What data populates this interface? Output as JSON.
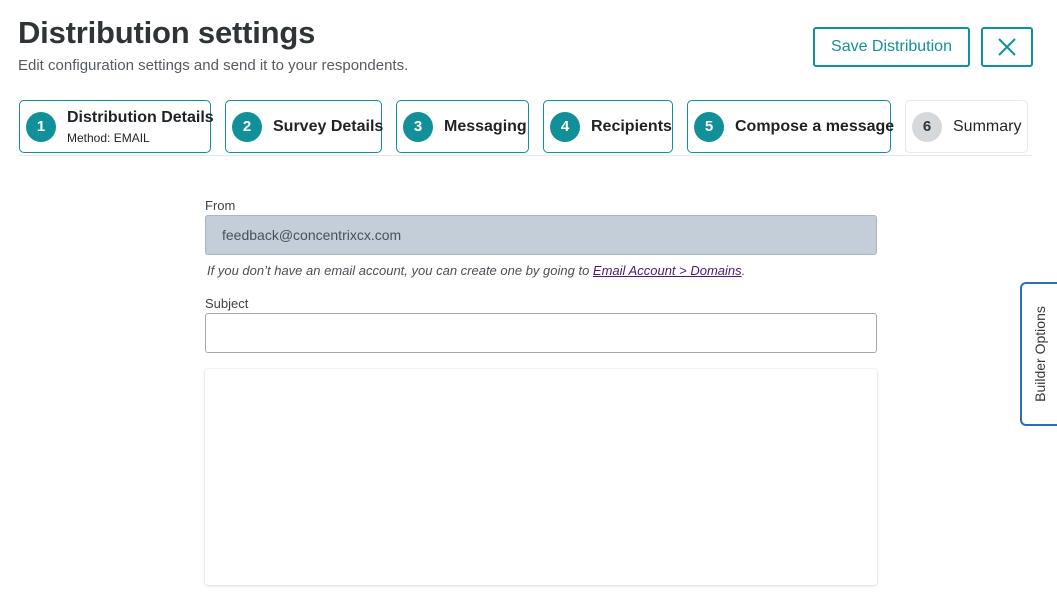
{
  "header": {
    "title": "Distribution settings",
    "subtitle": "Edit configuration settings and send it to your respondents.",
    "save_label": "Save Distribution",
    "close_icon": "close-icon"
  },
  "steps": [
    {
      "number": "1",
      "label": "Distribution Details",
      "sub": "Method: EMAIL",
      "state": "complete"
    },
    {
      "number": "2",
      "label": "Survey Details",
      "state": "complete"
    },
    {
      "number": "3",
      "label": "Messaging",
      "state": "complete"
    },
    {
      "number": "4",
      "label": "Recipients",
      "state": "complete"
    },
    {
      "number": "5",
      "label": "Compose a message",
      "state": "current"
    },
    {
      "number": "6",
      "label": "Summary",
      "state": "upcoming"
    }
  ],
  "form": {
    "from_label": "From",
    "from_value": "feedback@concentrixcx.com",
    "helper_prefix": "If you don’t have an email account, you can create one by going to ",
    "helper_link": "Email Account > Domains",
    "helper_suffix": ".",
    "subject_label": "Subject",
    "subject_value": ""
  },
  "builder_tab_label": "Builder Options",
  "colors": {
    "accent": "#12909a",
    "builder_border": "#2a6fb5",
    "disabled_input": "#c3ced9",
    "link": "#4b1a7a"
  }
}
